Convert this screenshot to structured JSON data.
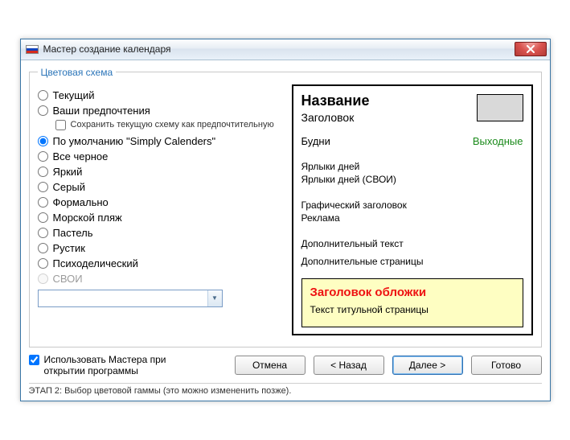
{
  "window": {
    "title": "Мастер создание календаря"
  },
  "group": {
    "legend": "Цветовая схема"
  },
  "schemes": {
    "options": [
      {
        "id": "current",
        "label": "Текущий"
      },
      {
        "id": "prefs",
        "label": "Ваши предпочтения"
      },
      {
        "id": "default",
        "label": "По умолчанию \"Simply Calenders\""
      },
      {
        "id": "black",
        "label": "Все черное"
      },
      {
        "id": "bright",
        "label": "Яркий"
      },
      {
        "id": "gray",
        "label": "Серый"
      },
      {
        "id": "formal",
        "label": "Формально"
      },
      {
        "id": "beach",
        "label": "Морской пляж"
      },
      {
        "id": "pastel",
        "label": "Пастель"
      },
      {
        "id": "rustic",
        "label": "Рустик"
      },
      {
        "id": "psyche",
        "label": "Психоделический"
      },
      {
        "id": "own",
        "label": "СВОИ",
        "disabled": true
      }
    ],
    "selected": "default",
    "save_pref_label": "Сохранить текущую схему как предпочтительную",
    "save_pref_checked": false,
    "combo_value": ""
  },
  "preview": {
    "title": "Название",
    "subtitle": "Заголовок",
    "weekdays": "Будни",
    "weekends": "Выходные",
    "day_labels": "Ярлыки дней",
    "day_labels_own": "Ярлыки дней (СВОИ)",
    "graphic_header": "Графический заголовок",
    "advert": "Реклама",
    "extra_text": "Дополнительный текст",
    "extra_pages": "Дополнительные страницы",
    "cover_title": "Заголовок обложки",
    "cover_text": "Текст титульной страницы"
  },
  "footer": {
    "use_wizard_label": "Использовать Мастера при открытии программы",
    "use_wizard_checked": true,
    "buttons": {
      "cancel": "Отмена",
      "back": "< Назад",
      "next": "Далее >",
      "finish": "Готово"
    },
    "status": "ЭТАП 2: Выбор цветовой гаммы (это можно измененить позже)."
  }
}
